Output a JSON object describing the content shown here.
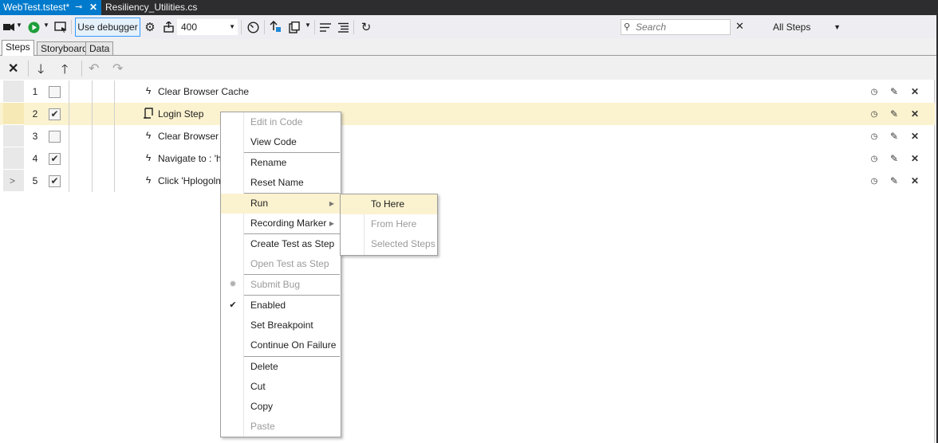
{
  "tabs": [
    {
      "label": "WebTest.tstest*",
      "active": true
    },
    {
      "label": "Resiliency_Utilities.cs",
      "active": false
    }
  ],
  "toolbar": {
    "use_debugger_label": "Use debugger",
    "speed_value": "400",
    "search_placeholder": "Search",
    "filter_value": "All Steps"
  },
  "subtabs": [
    {
      "label": "Steps",
      "active": true
    },
    {
      "label": "Storyboard",
      "active": false
    },
    {
      "label": "Data",
      "active": false
    }
  ],
  "steps": [
    {
      "num": "1",
      "checked": false,
      "icon": "lightning-icon",
      "text": "Clear Browser Cache",
      "selected": false,
      "expander": ""
    },
    {
      "num": "2",
      "checked": true,
      "icon": "test-step-icon",
      "text": "Login Step",
      "selected": true,
      "expander": ""
    },
    {
      "num": "3",
      "checked": false,
      "icon": "lightning-icon",
      "text": "Clear Browser C",
      "selected": false,
      "expander": ""
    },
    {
      "num": "4",
      "checked": true,
      "icon": "lightning-icon",
      "text": "Navigate to : 'htt",
      "selected": false,
      "expander": ""
    },
    {
      "num": "5",
      "checked": true,
      "icon": "lightning-icon",
      "text": "Click 'Hplogolma",
      "selected": false,
      "expander": ">"
    }
  ],
  "context_menu": {
    "items": [
      {
        "label": "Edit in Code",
        "disabled": true
      },
      {
        "label": "View Code",
        "disabled": false
      },
      {
        "label": "Rename",
        "disabled": false
      },
      {
        "label": "Reset Name",
        "disabled": false
      },
      {
        "label": "Run",
        "disabled": false,
        "submenu": true,
        "highlighted": true
      },
      {
        "label": "Recording Marker",
        "disabled": false,
        "submenu": true
      },
      {
        "label": "Create Test as Step",
        "disabled": false
      },
      {
        "label": "Open Test as Step",
        "disabled": true
      },
      {
        "label": "Submit Bug",
        "disabled": true
      },
      {
        "label": "Enabled",
        "disabled": false,
        "checked": true
      },
      {
        "label": "Set Breakpoint",
        "disabled": false
      },
      {
        "label": "Continue On Failure",
        "disabled": false
      },
      {
        "label": "Delete",
        "disabled": false
      },
      {
        "label": "Cut",
        "disabled": false
      },
      {
        "label": "Copy",
        "disabled": false
      },
      {
        "label": "Paste",
        "disabled": true
      }
    ],
    "check_glyph": "✔",
    "bug_glyph": "✹"
  },
  "run_submenu": {
    "items": [
      {
        "label": "To Here",
        "disabled": false,
        "highlighted": true
      },
      {
        "label": "From Here",
        "disabled": true
      },
      {
        "label": "Selected Steps",
        "disabled": true
      }
    ]
  },
  "colors": {
    "active_tab": "#007acc",
    "selection": "#fbf2cf",
    "chrome": "#2d2d30"
  }
}
